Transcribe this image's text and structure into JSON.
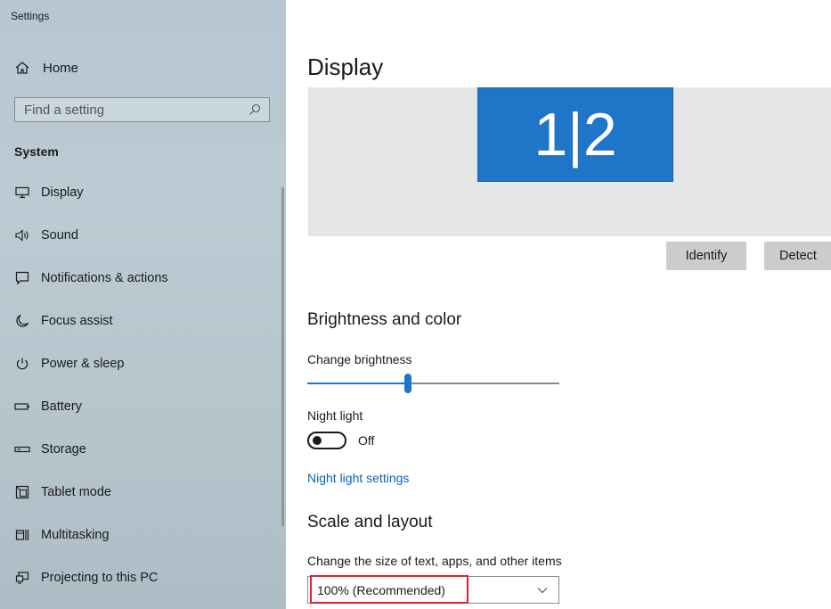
{
  "window": {
    "title": "Settings"
  },
  "sidebar": {
    "home_label": "Home",
    "search_placeholder": "Find a setting",
    "section_title": "System",
    "items": [
      {
        "label": "Display",
        "icon": "monitor-icon"
      },
      {
        "label": "Sound",
        "icon": "speaker-icon"
      },
      {
        "label": "Notifications & actions",
        "icon": "notification-icon"
      },
      {
        "label": "Focus assist",
        "icon": "moon-icon"
      },
      {
        "label": "Power & sleep",
        "icon": "power-icon"
      },
      {
        "label": "Battery",
        "icon": "battery-icon"
      },
      {
        "label": "Storage",
        "icon": "storage-icon"
      },
      {
        "label": "Tablet mode",
        "icon": "tablet-mode-icon"
      },
      {
        "label": "Multitasking",
        "icon": "multitasking-icon"
      },
      {
        "label": "Projecting to this PC",
        "icon": "projecting-icon"
      }
    ]
  },
  "main": {
    "title": "Display",
    "arrangement": {
      "monitor_label": "1|2",
      "monitor_color": "#1f75c7"
    },
    "identify_label": "Identify",
    "detect_label": "Detect",
    "brightness_section": "Brightness and color",
    "brightness_label": "Change brightness",
    "brightness_value": 0.4,
    "night_light_label": "Night light",
    "night_light_state": "Off",
    "night_light_link": "Night light settings",
    "scale_section": "Scale and layout",
    "scale_label": "Change the size of text, apps, and other items",
    "scale_value": "100% (Recommended)"
  },
  "colors": {
    "accent": "#1f75c7",
    "link": "#0b62b8",
    "highlight_box": "#d9232e"
  }
}
